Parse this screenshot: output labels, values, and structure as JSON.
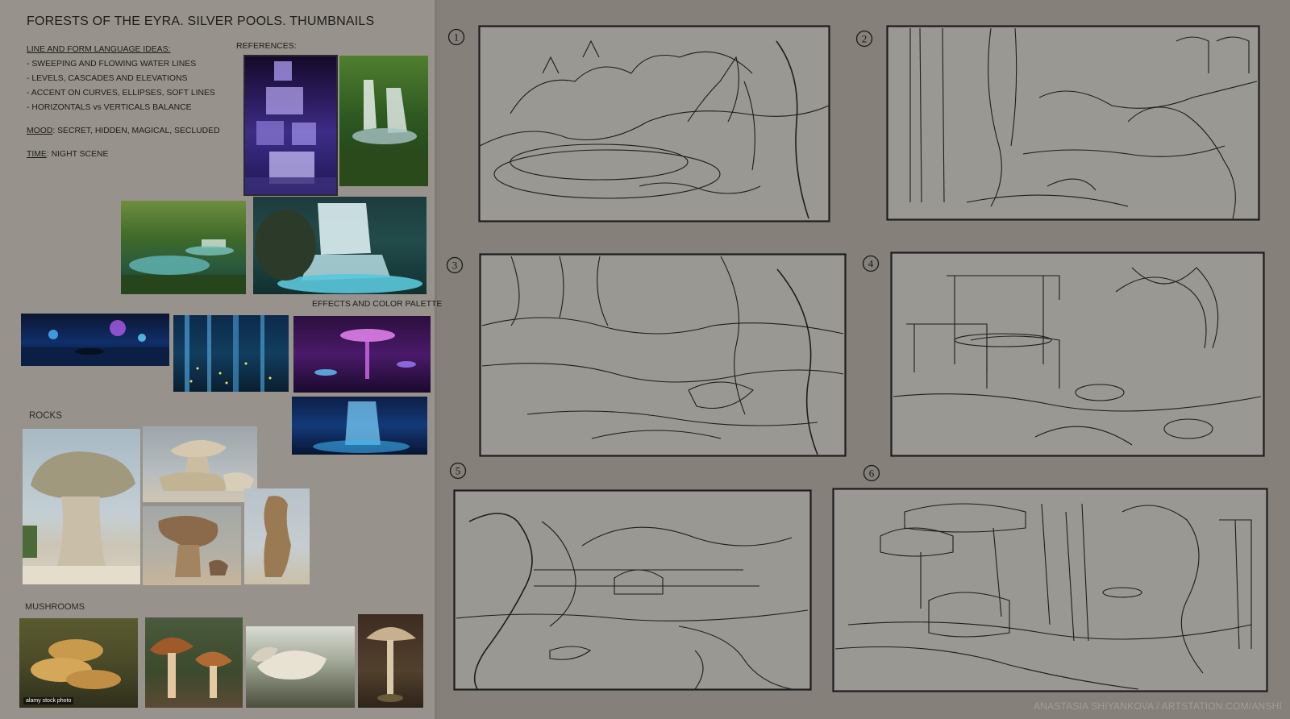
{
  "header": {
    "title": "FORESTS OF THE EYRA. SILVER POOLS. THUMBNAILS"
  },
  "notes": {
    "line_heading": "LINE AND FORM LANGUAGE IDEAS:",
    "line_items": [
      "- SWEEPING AND FLOWING WATER LINES",
      "- LEVELS, CASCADES AND ELEVATIONS",
      "- ACCENT ON CURVES, ELLIPSES, SOFT LINES",
      "- HORIZONTALS vs VERTICALS BALANCE"
    ],
    "mood_label": "MOOD",
    "mood_value": ": SECRET, HIDDEN, MAGICAL, SECLUDED",
    "time_label": "TIME",
    "time_value": ": NIGHT SCENE"
  },
  "references": {
    "label": "REFERENCES:",
    "effects_label": "EFFECTS AND COLOR PALETTE",
    "rocks_label": "ROCKS",
    "mushrooms_label": "MUSHROOMS",
    "stock_watermark": "alamy stock photo"
  },
  "thumbnails": [
    {
      "number": "1"
    },
    {
      "number": "2"
    },
    {
      "number": "3"
    },
    {
      "number": "4"
    },
    {
      "number": "5"
    },
    {
      "number": "6"
    }
  ],
  "credit": "ANASTASIA SHIYANKOVA / ARTSTATION.COM/ANSHI"
}
